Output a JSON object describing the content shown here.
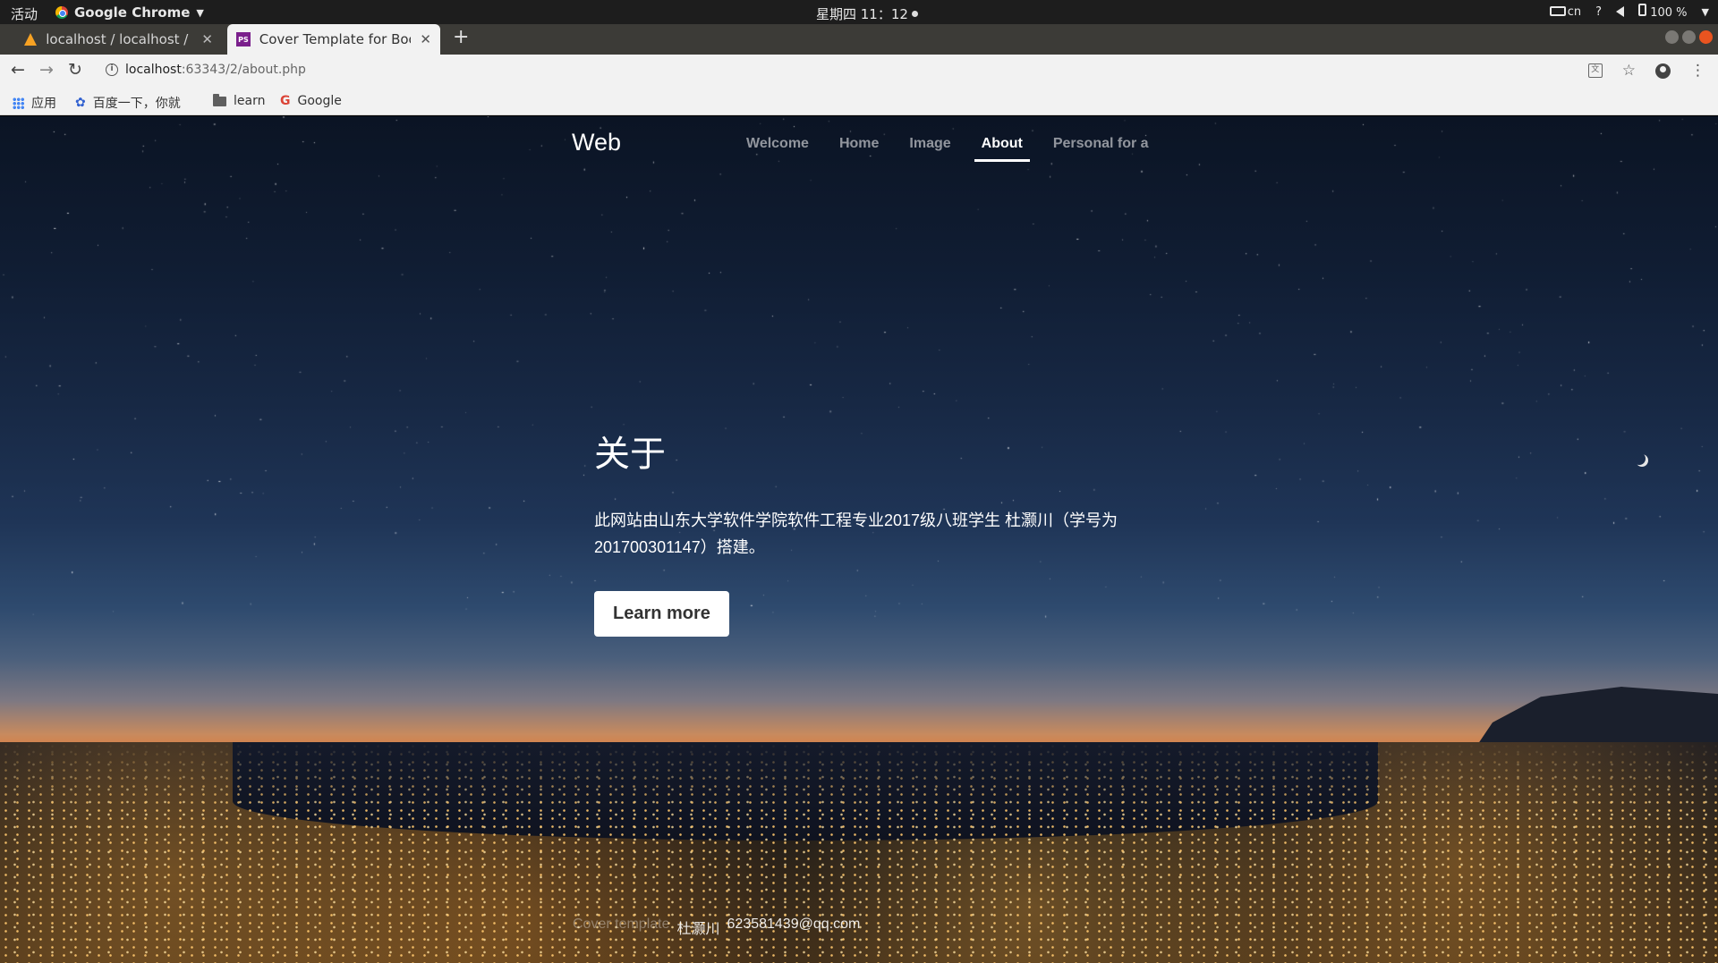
{
  "os": {
    "activities": "活动",
    "app_name": "Google Chrome",
    "clock": "星期四 11：12",
    "input_method": "cn",
    "help": "?",
    "battery": "100 %"
  },
  "tabs": [
    {
      "title": "localhost / localhost / dat",
      "icon": "phpmyadmin-icon"
    },
    {
      "title": "Cover Template for Boots",
      "icon": "phpstorm-icon"
    }
  ],
  "address": {
    "host": "localhost",
    "path": ":63343/2/about.php"
  },
  "bookmarks": [
    {
      "label": "应用",
      "icon": "apps-icon"
    },
    {
      "label": "百度一下，你就",
      "icon": "baidu-icon"
    },
    {
      "label": "learn",
      "icon": "folder-icon"
    },
    {
      "label": "Google",
      "icon": "google-icon"
    }
  ],
  "site": {
    "brand": "Web",
    "nav": [
      {
        "label": "Welcome",
        "active": false
      },
      {
        "label": "Home",
        "active": false
      },
      {
        "label": "Image",
        "active": false
      },
      {
        "label": "About",
        "active": true
      },
      {
        "label": "Personal for a",
        "active": false
      }
    ],
    "heading": "关于",
    "paragraph": "此网站由山东大学软件学院软件工程专业2017级八班学生 杜灏川（学号为201700301147）搭建。",
    "button": "Learn more",
    "footer": {
      "faint_prefix": "Cover template",
      "name": "杜灏川",
      "email": "623581439@qq.com"
    }
  },
  "colors": {
    "os_bar": "#1d1d1d",
    "tab_strip": "#3c3b37",
    "toolbar": "#f2f2f2",
    "close_button": "#e95420"
  }
}
